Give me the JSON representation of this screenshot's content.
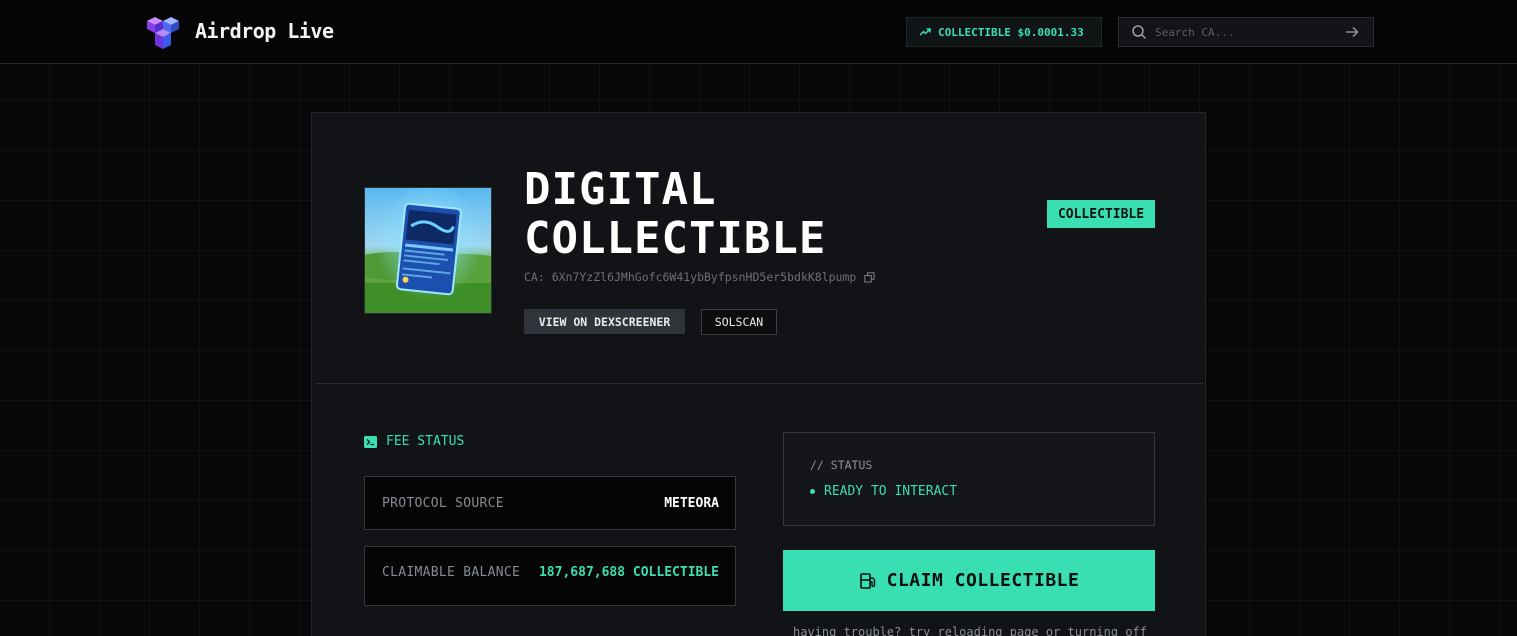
{
  "header": {
    "brand": "Airdrop Live",
    "ticker": "COLLECTIBLE $0.0001.33",
    "search_placeholder": "Search CA..."
  },
  "token": {
    "title_line1": "DIGITAL",
    "title_line2": "COLLECTIBLE",
    "ca": "CA: 6Xn7YzZl6JMhGofc6W41ybByfpsnHD5er5bdkK8lpump",
    "badge": "COLLECTIBLE",
    "dex_button": "VIEW ON DEXSCREENER",
    "solscan_button": "SOLSCAN"
  },
  "fee": {
    "heading": "FEE STATUS",
    "rows": [
      {
        "label": "PROTOCOL SOURCE",
        "value": "METEORA"
      },
      {
        "label": "CLAIMABLE BALANCE",
        "value": "187,687,688 COLLECTIBLE"
      }
    ]
  },
  "status": {
    "caption": "// STATUS",
    "state": "READY TO INTERACT"
  },
  "claim": {
    "label": "CLAIM COLLECTIBLE",
    "hint": "having trouble? try reloading page or turning off"
  },
  "colors": {
    "accent": "#39dfb2",
    "background": "#07080a",
    "card": "#111316"
  },
  "icons": [
    "cube-logo-icon",
    "trending-up-icon",
    "search-icon",
    "arrow-right-icon",
    "copy-icon",
    "terminal-icon",
    "fuel-icon"
  ]
}
